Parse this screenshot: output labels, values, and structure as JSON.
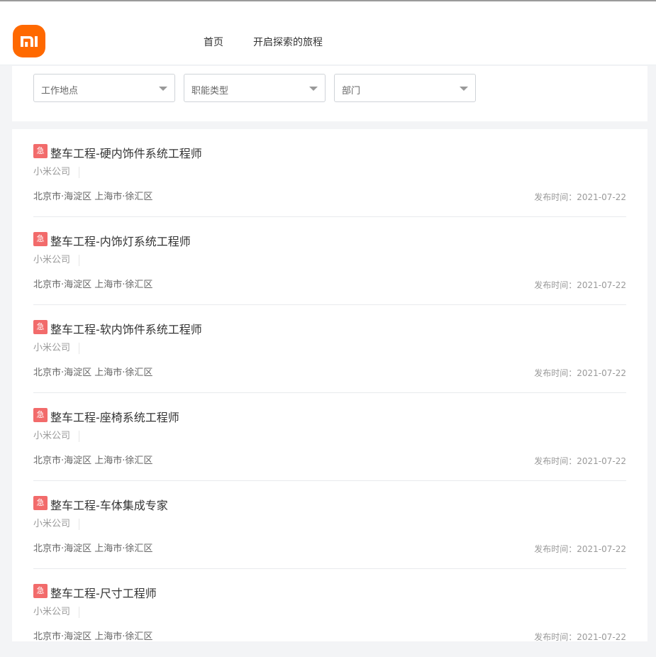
{
  "brand": {
    "name": "MI",
    "color": "#ff6900"
  },
  "nav": {
    "home": "首页",
    "journey": "开启探索的旅程"
  },
  "filters": {
    "location": "工作地点",
    "function": "职能类型",
    "department": "部门"
  },
  "urgent_label": "急",
  "jobs": [
    {
      "title": "整车工程-硬内饰件系统工程师",
      "company": "小米公司",
      "location": "北京市·海淀区  上海市·徐汇区",
      "date": "发布时间：2021-07-22"
    },
    {
      "title": "整车工程-内饰灯系统工程师",
      "company": "小米公司",
      "location": "北京市·海淀区  上海市·徐汇区",
      "date": "发布时间：2021-07-22"
    },
    {
      "title": "整车工程-软内饰件系统工程师",
      "company": "小米公司",
      "location": "北京市·海淀区  上海市·徐汇区",
      "date": "发布时间：2021-07-22"
    },
    {
      "title": "整车工程-座椅系统工程师",
      "company": "小米公司",
      "location": "北京市·海淀区  上海市·徐汇区",
      "date": "发布时间：2021-07-22"
    },
    {
      "title": "整车工程-车体集成专家",
      "company": "小米公司",
      "location": "北京市·海淀区  上海市·徐汇区",
      "date": "发布时间：2021-07-22"
    },
    {
      "title": "整车工程-尺寸工程师",
      "company": "小米公司",
      "location": "北京市·海淀区  上海市·徐汇区",
      "date": "发布时间：2021-07-22"
    }
  ]
}
